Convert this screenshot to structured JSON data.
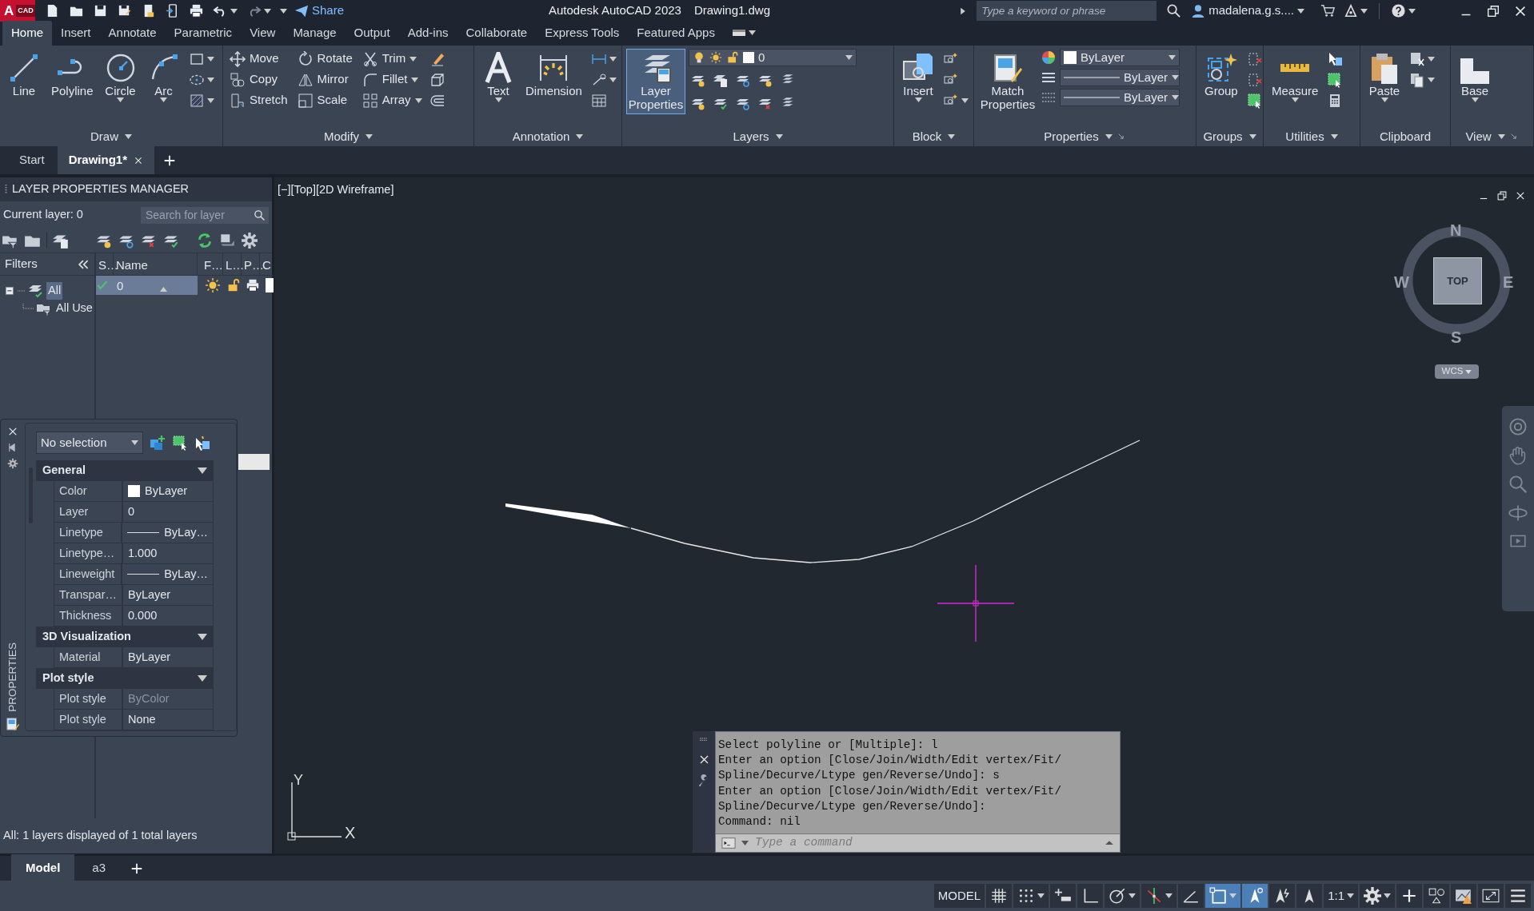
{
  "title_bar": {
    "logo_letter": "A",
    "logo_text": "CAD",
    "share": "Share",
    "app_title": "Autodesk AutoCAD 2023",
    "document": "Drawing1.dwg",
    "search": {
      "placeholder": "Type a keyword or phrase"
    },
    "user": "madalena.g.s...."
  },
  "ribbon_tabs": [
    {
      "label": "Home",
      "selected": true
    },
    {
      "label": "Insert",
      "selected": false
    },
    {
      "label": "Annotate",
      "selected": false
    },
    {
      "label": "Parametric",
      "selected": false
    },
    {
      "label": "View",
      "selected": false
    },
    {
      "label": "Manage",
      "selected": false
    },
    {
      "label": "Output",
      "selected": false
    },
    {
      "label": "Add-ins",
      "selected": false
    },
    {
      "label": "Collaborate",
      "selected": false
    },
    {
      "label": "Express Tools",
      "selected": false
    },
    {
      "label": "Featured Apps",
      "selected": false
    }
  ],
  "ribbon_panels": [
    {
      "kind": "draw",
      "title": "Draw",
      "menu": true,
      "tools": [
        {
          "label": "Line",
          "caret": false,
          "highlighted": false
        },
        {
          "label": "Polyline",
          "caret": false,
          "highlighted": false
        },
        {
          "label": "Circle",
          "caret": true,
          "highlighted": false
        },
        {
          "label": "Arc",
          "caret": true,
          "highlighted": false
        }
      ]
    },
    {
      "kind": "modify",
      "title": "Modify",
      "menu": true,
      "tools": [
        {
          "label": "Move",
          "caret": false,
          "highlighted": false
        },
        {
          "label": "Rotate",
          "caret": false,
          "highlighted": false
        },
        {
          "label": "Trim",
          "caret": true,
          "highlighted": false
        },
        {
          "label": "Copy",
          "caret": false,
          "highlighted": false
        },
        {
          "label": "Mirror",
          "caret": false,
          "highlighted": false
        },
        {
          "label": "Fillet",
          "caret": true,
          "highlighted": false
        },
        {
          "label": "Stretch",
          "caret": false,
          "highlighted": false
        },
        {
          "label": "Scale",
          "caret": false,
          "highlighted": false
        },
        {
          "label": "Array",
          "caret": true,
          "highlighted": false
        }
      ]
    },
    {
      "kind": "annotation",
      "title": "Annotation",
      "menu": true,
      "tools": [
        {
          "label": "Text",
          "caret": true,
          "highlighted": false
        },
        {
          "label": "Dimension",
          "caret": false,
          "highlighted": false
        }
      ]
    },
    {
      "kind": "layers",
      "title": "Layers",
      "menu": true,
      "layer_dropdown": "0",
      "tools": [
        {
          "label": "Layer Properties",
          "caret": false,
          "highlighted": true
        }
      ]
    },
    {
      "kind": "block",
      "title": "Block",
      "menu": true,
      "tools": [
        {
          "label": "Insert",
          "caret": true,
          "highlighted": false
        }
      ]
    },
    {
      "kind": "properties",
      "title": "Properties",
      "menu": true,
      "dropdowns": [
        "ByLayer",
        "ByLayer",
        "ByLayer"
      ],
      "tools": [
        {
          "label": "Match Properties",
          "caret": false,
          "highlighted": false
        }
      ]
    },
    {
      "kind": "groups",
      "title": "Groups",
      "menu": true,
      "tools": [
        {
          "label": "Group",
          "caret": false,
          "highlighted": false
        }
      ]
    },
    {
      "kind": "utilities",
      "title": "Utilities",
      "menu": true,
      "tools": [
        {
          "label": "Measure",
          "caret": true,
          "highlighted": false
        }
      ]
    },
    {
      "kind": "clipboard",
      "title": "Clipboard",
      "menu": false,
      "tools": [
        {
          "label": "Paste",
          "caret": true,
          "highlighted": false
        }
      ]
    },
    {
      "kind": "view",
      "title": "View",
      "menu": true,
      "tools": [
        {
          "label": "Base",
          "caret": true,
          "highlighted": false
        }
      ]
    }
  ],
  "document_tabs": [
    {
      "label": "Start",
      "selected": false,
      "closable": false
    },
    {
      "label": "Drawing1*",
      "selected": true,
      "closable": true
    }
  ],
  "layer_manager": {
    "title": "LAYER PROPERTIES MANAGER",
    "current_layer": "Current layer: 0",
    "search": {
      "placeholder": "Search for layer"
    },
    "filters_title": "Filters",
    "filter_tree": [
      {
        "label": "All",
        "selected": true,
        "expanded": true,
        "children": [
          {
            "label": "All Use",
            "selected": false
          }
        ]
      }
    ],
    "columns": [
      "S…",
      "Name",
      "F…",
      "L…",
      "P…",
      "C"
    ],
    "layers": [
      {
        "name": "0",
        "current": true,
        "selected": true,
        "frozen": false,
        "locked": false,
        "color": "#ffffff"
      }
    ],
    "footer": "All: 1 layers displayed of 1 total layers"
  },
  "properties_palette": {
    "side_label": "PROPERTIES",
    "selection": "No selection",
    "sections": [
      {
        "title": "General",
        "expanded": true,
        "rows": [
          {
            "label": "Color",
            "value": "ByLayer",
            "kind": "color",
            "disabled": false
          },
          {
            "label": "Layer",
            "value": "0",
            "kind": "text",
            "disabled": false
          },
          {
            "label": "Linetype",
            "value": "ByLay…",
            "kind": "line",
            "disabled": false
          },
          {
            "label": "Linetype…",
            "value": "1.000",
            "kind": "text",
            "disabled": false
          },
          {
            "label": "Lineweight",
            "value": "ByLay…",
            "kind": "line",
            "disabled": false
          },
          {
            "label": "Transpar…",
            "value": "ByLayer",
            "kind": "text",
            "disabled": false
          },
          {
            "label": "Thickness",
            "value": "0.000",
            "kind": "text",
            "disabled": false
          }
        ]
      },
      {
        "title": "3D Visualization",
        "expanded": true,
        "rows": [
          {
            "label": "Material",
            "value": "ByLayer",
            "kind": "text",
            "disabled": false
          }
        ]
      },
      {
        "title": "Plot style",
        "expanded": true,
        "rows": [
          {
            "label": "Plot style",
            "value": "ByColor",
            "kind": "text",
            "disabled": true
          },
          {
            "label": "Plot style",
            "value": "None",
            "kind": "text",
            "disabled": false
          }
        ]
      }
    ]
  },
  "drawing": {
    "viewport_label": "[−][Top][2D Wireframe]",
    "viewcube": {
      "face": "TOP",
      "north": "N",
      "south": "S",
      "east": "E",
      "west": "W",
      "ucs": "WCS"
    },
    "axes": {
      "x": "X",
      "y": "Y"
    }
  },
  "command_line": {
    "history": [
      "Select polyline or [Multiple]: l",
      "Enter an option [Close/Join/Width/Edit vertex/Fit/",
      "Spline/Decurve/Ltype gen/Reverse/Undo]: s",
      "Enter an option [Close/Join/Width/Edit vertex/Fit/",
      "Spline/Decurve/Ltype gen/Reverse/Undo]:",
      "Command: nil"
    ],
    "placeholder": "Type a command"
  },
  "layout_tabs": [
    {
      "label": "Model",
      "selected": true
    },
    {
      "label": "a3",
      "selected": false
    }
  ],
  "status_bar": {
    "items": [
      {
        "kind": "model",
        "label": "MODEL",
        "on": false,
        "caret": false
      },
      {
        "kind": "grid",
        "on": false,
        "caret": false
      },
      {
        "kind": "snap",
        "on": false,
        "caret": true
      },
      {
        "kind": "infer",
        "on": false,
        "caret": false
      },
      {
        "kind": "ortho",
        "on": false,
        "caret": false
      },
      {
        "kind": "polar",
        "on": false,
        "caret": true
      },
      {
        "kind": "isodraft",
        "on": false,
        "caret": true
      },
      {
        "kind": "angle",
        "on": false,
        "caret": false
      },
      {
        "kind": "selcycle",
        "on": true,
        "caret": true
      },
      {
        "kind": "annovis",
        "on": true,
        "caret": false
      },
      {
        "kind": "autoscale",
        "on": false,
        "caret": false
      },
      {
        "kind": "annomon",
        "on": false,
        "caret": false
      },
      {
        "kind": "scale",
        "label": "1:1",
        "on": false,
        "caret": true
      },
      {
        "kind": "gear",
        "on": false,
        "caret": true
      },
      {
        "kind": "plus",
        "on": false,
        "caret": false
      },
      {
        "kind": "isolate",
        "on": false,
        "caret": false
      },
      {
        "kind": "hardware",
        "on": false,
        "caret": false
      },
      {
        "kind": "fullscreen",
        "on": false,
        "caret": false
      },
      {
        "kind": "menu",
        "on": false,
        "caret": false
      }
    ]
  }
}
